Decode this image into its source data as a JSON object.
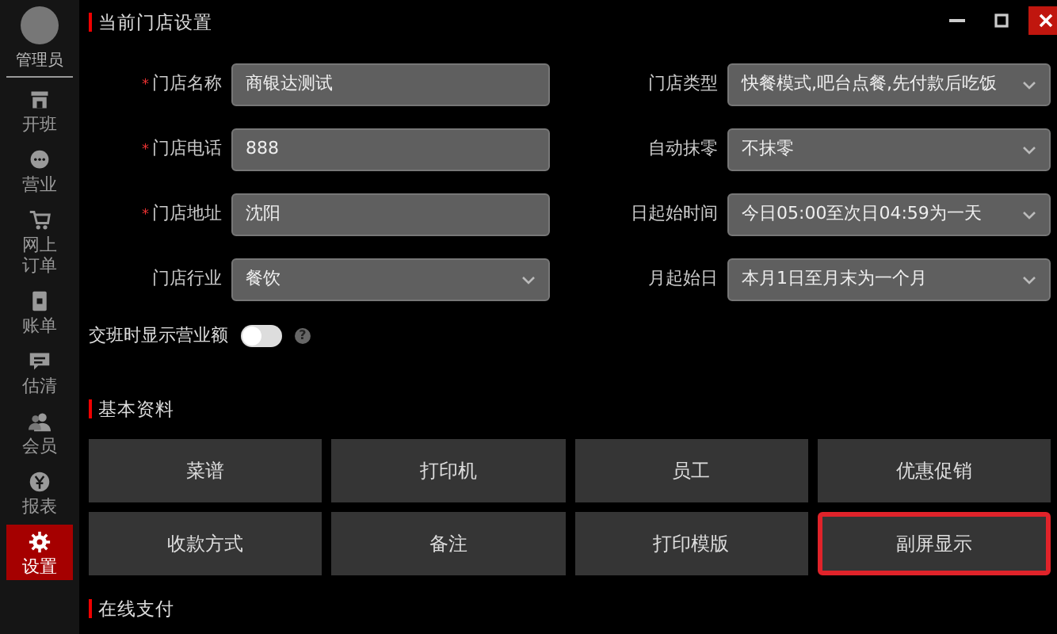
{
  "sidebar": {
    "user": {
      "label": "管理员"
    },
    "items": [
      {
        "label": "开班",
        "selected": false
      },
      {
        "label": "营业",
        "selected": false
      },
      {
        "label": "网上订单",
        "selected": false
      },
      {
        "label": "账单",
        "selected": false
      },
      {
        "label": "估清",
        "selected": false
      },
      {
        "label": "会员",
        "selected": false
      },
      {
        "label": "报表",
        "selected": false
      },
      {
        "label": "设置",
        "selected": true
      }
    ]
  },
  "store_settings": {
    "title": "当前门店设置",
    "fields": [
      {
        "label": "门店名称",
        "required_mark": "*",
        "kind": "input",
        "value": "商银达测试"
      },
      {
        "label": "门店类型",
        "kind": "select",
        "value": "快餐模式,吧台点餐,先付款后吃饭"
      },
      {
        "label": "门店电话",
        "required_mark": "*",
        "kind": "input",
        "value": "888"
      },
      {
        "label": "自动抹零",
        "kind": "select",
        "value": "不抹零"
      },
      {
        "label": "门店地址",
        "required_mark": "*",
        "kind": "input",
        "value": "沈阳"
      },
      {
        "label": "日起始时间",
        "kind": "select",
        "value": "今日05:00至次日04:59为一天"
      },
      {
        "label": "门店行业",
        "kind": "select",
        "value": "餐饮"
      },
      {
        "label": "月起始日",
        "kind": "select",
        "value": "本月1日至月末为一个月"
      }
    ],
    "toggle": {
      "label": "交班时显示营业额",
      "on": false,
      "help": "?"
    }
  },
  "basic_data": {
    "title": "基本资料",
    "buttons": [
      {
        "label": "菜谱",
        "highlighted": false
      },
      {
        "label": "打印机",
        "highlighted": false
      },
      {
        "label": "员工",
        "highlighted": false
      },
      {
        "label": "优惠促销",
        "highlighted": false
      },
      {
        "label": "收款方式",
        "highlighted": false
      },
      {
        "label": "备注",
        "highlighted": false
      },
      {
        "label": "打印模版",
        "highlighted": false
      },
      {
        "label": "副屏显示",
        "highlighted": true
      }
    ]
  },
  "online_payment": {
    "title": "在线支付"
  }
}
